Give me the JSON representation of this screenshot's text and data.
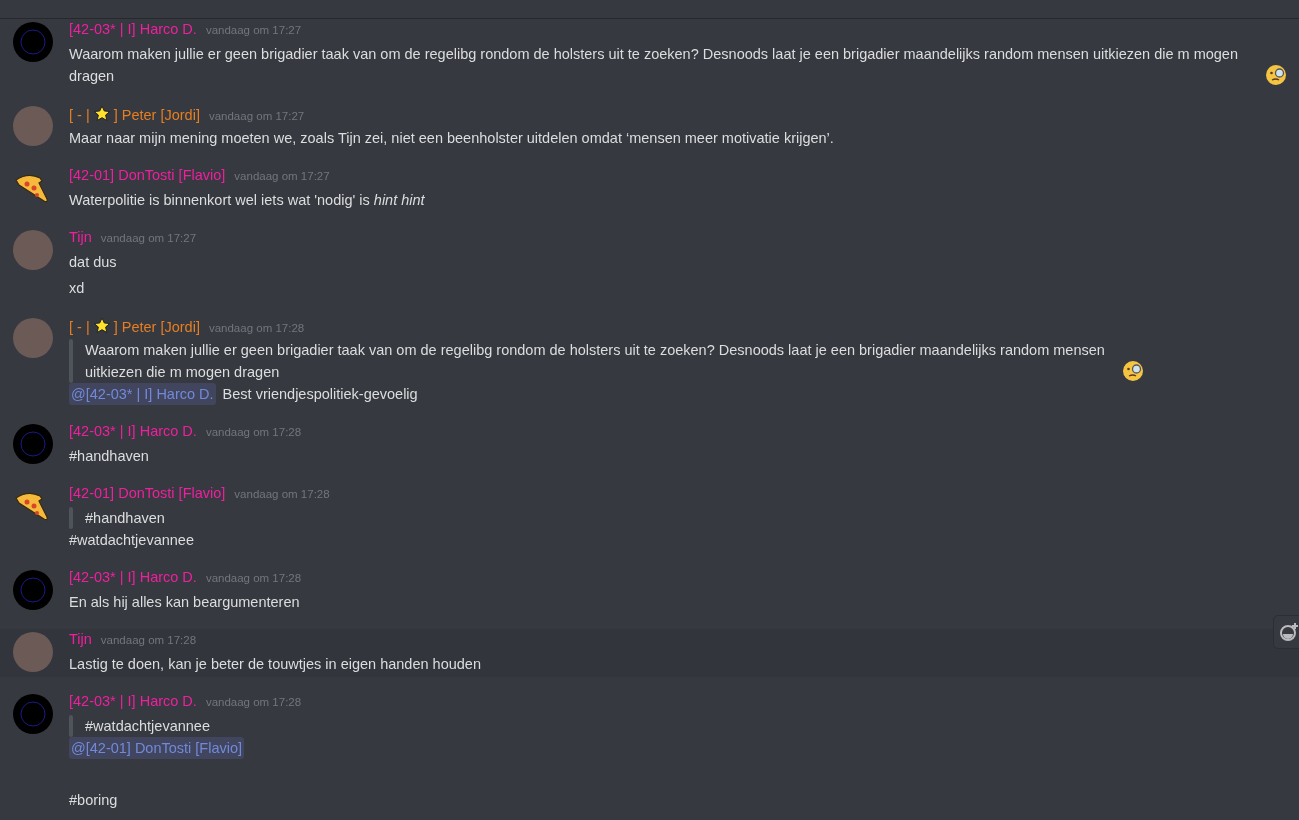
{
  "messages": [
    {
      "author": [
        {
          "kind": "text",
          "text": "[42-03* | I] Harco D."
        }
      ],
      "color": "#f01fa0",
      "timestamp": "vandaag om 17:27",
      "avatar": {
        "kind": "ring"
      },
      "hovered": false,
      "lines": [
        {
          "kind": "text",
          "parts": [
            {
              "kind": "text",
              "text": "Waarom maken jullie er geen brigadier taak van om de regelibg rondom de holsters uit te zoeken? Desnoods laat je een brigadier maandelijks random mensen uitkiezen die m mogen dragen"
            },
            {
              "kind": "emoji"
            }
          ]
        }
      ]
    },
    {
      "author": [
        {
          "kind": "text",
          "text": "[ - |"
        },
        {
          "kind": "star"
        },
        {
          "kind": "text",
          "text": "] Peter [Jordi]"
        }
      ],
      "color": "#e67e22",
      "timestamp": "vandaag om 17:27",
      "avatar": {
        "kind": "photo"
      },
      "hovered": false,
      "lines": [
        {
          "kind": "text",
          "parts": [
            {
              "kind": "text",
              "text": "Maar naar mijn mening moeten we, zoals Tijn zei, niet een beenholster uitdelen omdat ‘mensen meer motivatie krijgen’."
            }
          ]
        }
      ]
    },
    {
      "author": [
        {
          "kind": "text",
          "text": "[42-01] DonTosti [Flavio]"
        }
      ],
      "color": "#f01fa0",
      "timestamp": "vandaag om 17:27",
      "avatar": {
        "kind": "pizza"
      },
      "hovered": false,
      "lines": [
        {
          "kind": "text",
          "parts": [
            {
              "kind": "text",
              "text": "Waterpolitie is binnenkort wel iets wat 'nodig' is *hint hint*"
            }
          ]
        }
      ]
    },
    {
      "author": [
        {
          "kind": "text",
          "text": "Tijn"
        }
      ],
      "color": "#f01fa0",
      "timestamp": "vandaag om 17:27",
      "avatar": {
        "kind": "photo"
      },
      "hovered": false,
      "lines": [
        {
          "kind": "text",
          "parts": [
            {
              "kind": "text",
              "text": "dat dus"
            }
          ]
        },
        {
          "kind": "text",
          "parts": [
            {
              "kind": "text",
              "text": "xd"
            }
          ]
        }
      ]
    },
    {
      "author": [
        {
          "kind": "text",
          "text": "[ - |"
        },
        {
          "kind": "star"
        },
        {
          "kind": "text",
          "text": "] Peter [Jordi]"
        }
      ],
      "color": "#e67e22",
      "timestamp": "vandaag om 17:28",
      "avatar": {
        "kind": "photo"
      },
      "hovered": false,
      "lines": [
        {
          "kind": "quote",
          "parts": [
            {
              "kind": "text",
              "text": "Waarom maken jullie er geen brigadier taak van om de regelibg rondom de holsters uit te zoeken? Desnoods laat je een brigadier maandelijks random mensen uitkiezen die m mogen dragen"
            },
            {
              "kind": "emoji"
            }
          ]
        },
        {
          "kind": "text",
          "parts": [
            {
              "kind": "mention",
              "text": "@[42-03* | I] Harco D."
            },
            {
              "kind": "text",
              "text": "Best vriendjespolitiek-gevoelig"
            }
          ]
        }
      ]
    },
    {
      "author": [
        {
          "kind": "text",
          "text": "[42-03* | I] Harco D."
        }
      ],
      "color": "#f01fa0",
      "timestamp": "vandaag om 17:28",
      "avatar": {
        "kind": "ring"
      },
      "hovered": false,
      "lines": [
        {
          "kind": "text",
          "parts": [
            {
              "kind": "text",
              "text": "#handhaven"
            }
          ]
        }
      ]
    },
    {
      "author": [
        {
          "kind": "text",
          "text": "[42-01] DonTosti [Flavio]"
        }
      ],
      "color": "#f01fa0",
      "timestamp": "vandaag om 17:28",
      "avatar": {
        "kind": "pizza"
      },
      "hovered": false,
      "lines": [
        {
          "kind": "quote",
          "parts": [
            {
              "kind": "text",
              "text": "#handhaven"
            }
          ]
        },
        {
          "kind": "text",
          "parts": [
            {
              "kind": "text",
              "text": "#watdachtjevannee"
            }
          ]
        }
      ]
    },
    {
      "author": [
        {
          "kind": "text",
          "text": "[42-03* | I] Harco D."
        }
      ],
      "color": "#f01fa0",
      "timestamp": "vandaag om 17:28",
      "avatar": {
        "kind": "ring"
      },
      "hovered": false,
      "lines": [
        {
          "kind": "text",
          "parts": [
            {
              "kind": "text",
              "text": "En als hij alles kan beargumenteren"
            }
          ]
        }
      ]
    },
    {
      "author": [
        {
          "kind": "text",
          "text": "Tijn"
        }
      ],
      "color": "#f01fa0",
      "timestamp": "vandaag om 17:28",
      "avatar": {
        "kind": "photo"
      },
      "hovered": true,
      "lines": [
        {
          "kind": "text",
          "parts": [
            {
              "kind": "text",
              "text": "Lastig te doen, kan je beter de touwtjes in eigen handen houden"
            }
          ]
        }
      ]
    },
    {
      "author": [
        {
          "kind": "text",
          "text": "[42-03* | I] Harco D."
        }
      ],
      "color": "#f01fa0",
      "timestamp": "vandaag om 17:28",
      "avatar": {
        "kind": "ring"
      },
      "hovered": false,
      "lines": [
        {
          "kind": "quote",
          "parts": [
            {
              "kind": "text",
              "text": "#watdachtjevannee"
            }
          ]
        },
        {
          "kind": "text",
          "parts": [
            {
              "kind": "mention",
              "text": "@[42-01] DonTosti [Flavio]"
            }
          ]
        },
        {
          "kind": "blank"
        },
        {
          "kind": "text",
          "parts": [
            {
              "kind": "text",
              "text": "#boring"
            }
          ]
        }
      ]
    }
  ]
}
